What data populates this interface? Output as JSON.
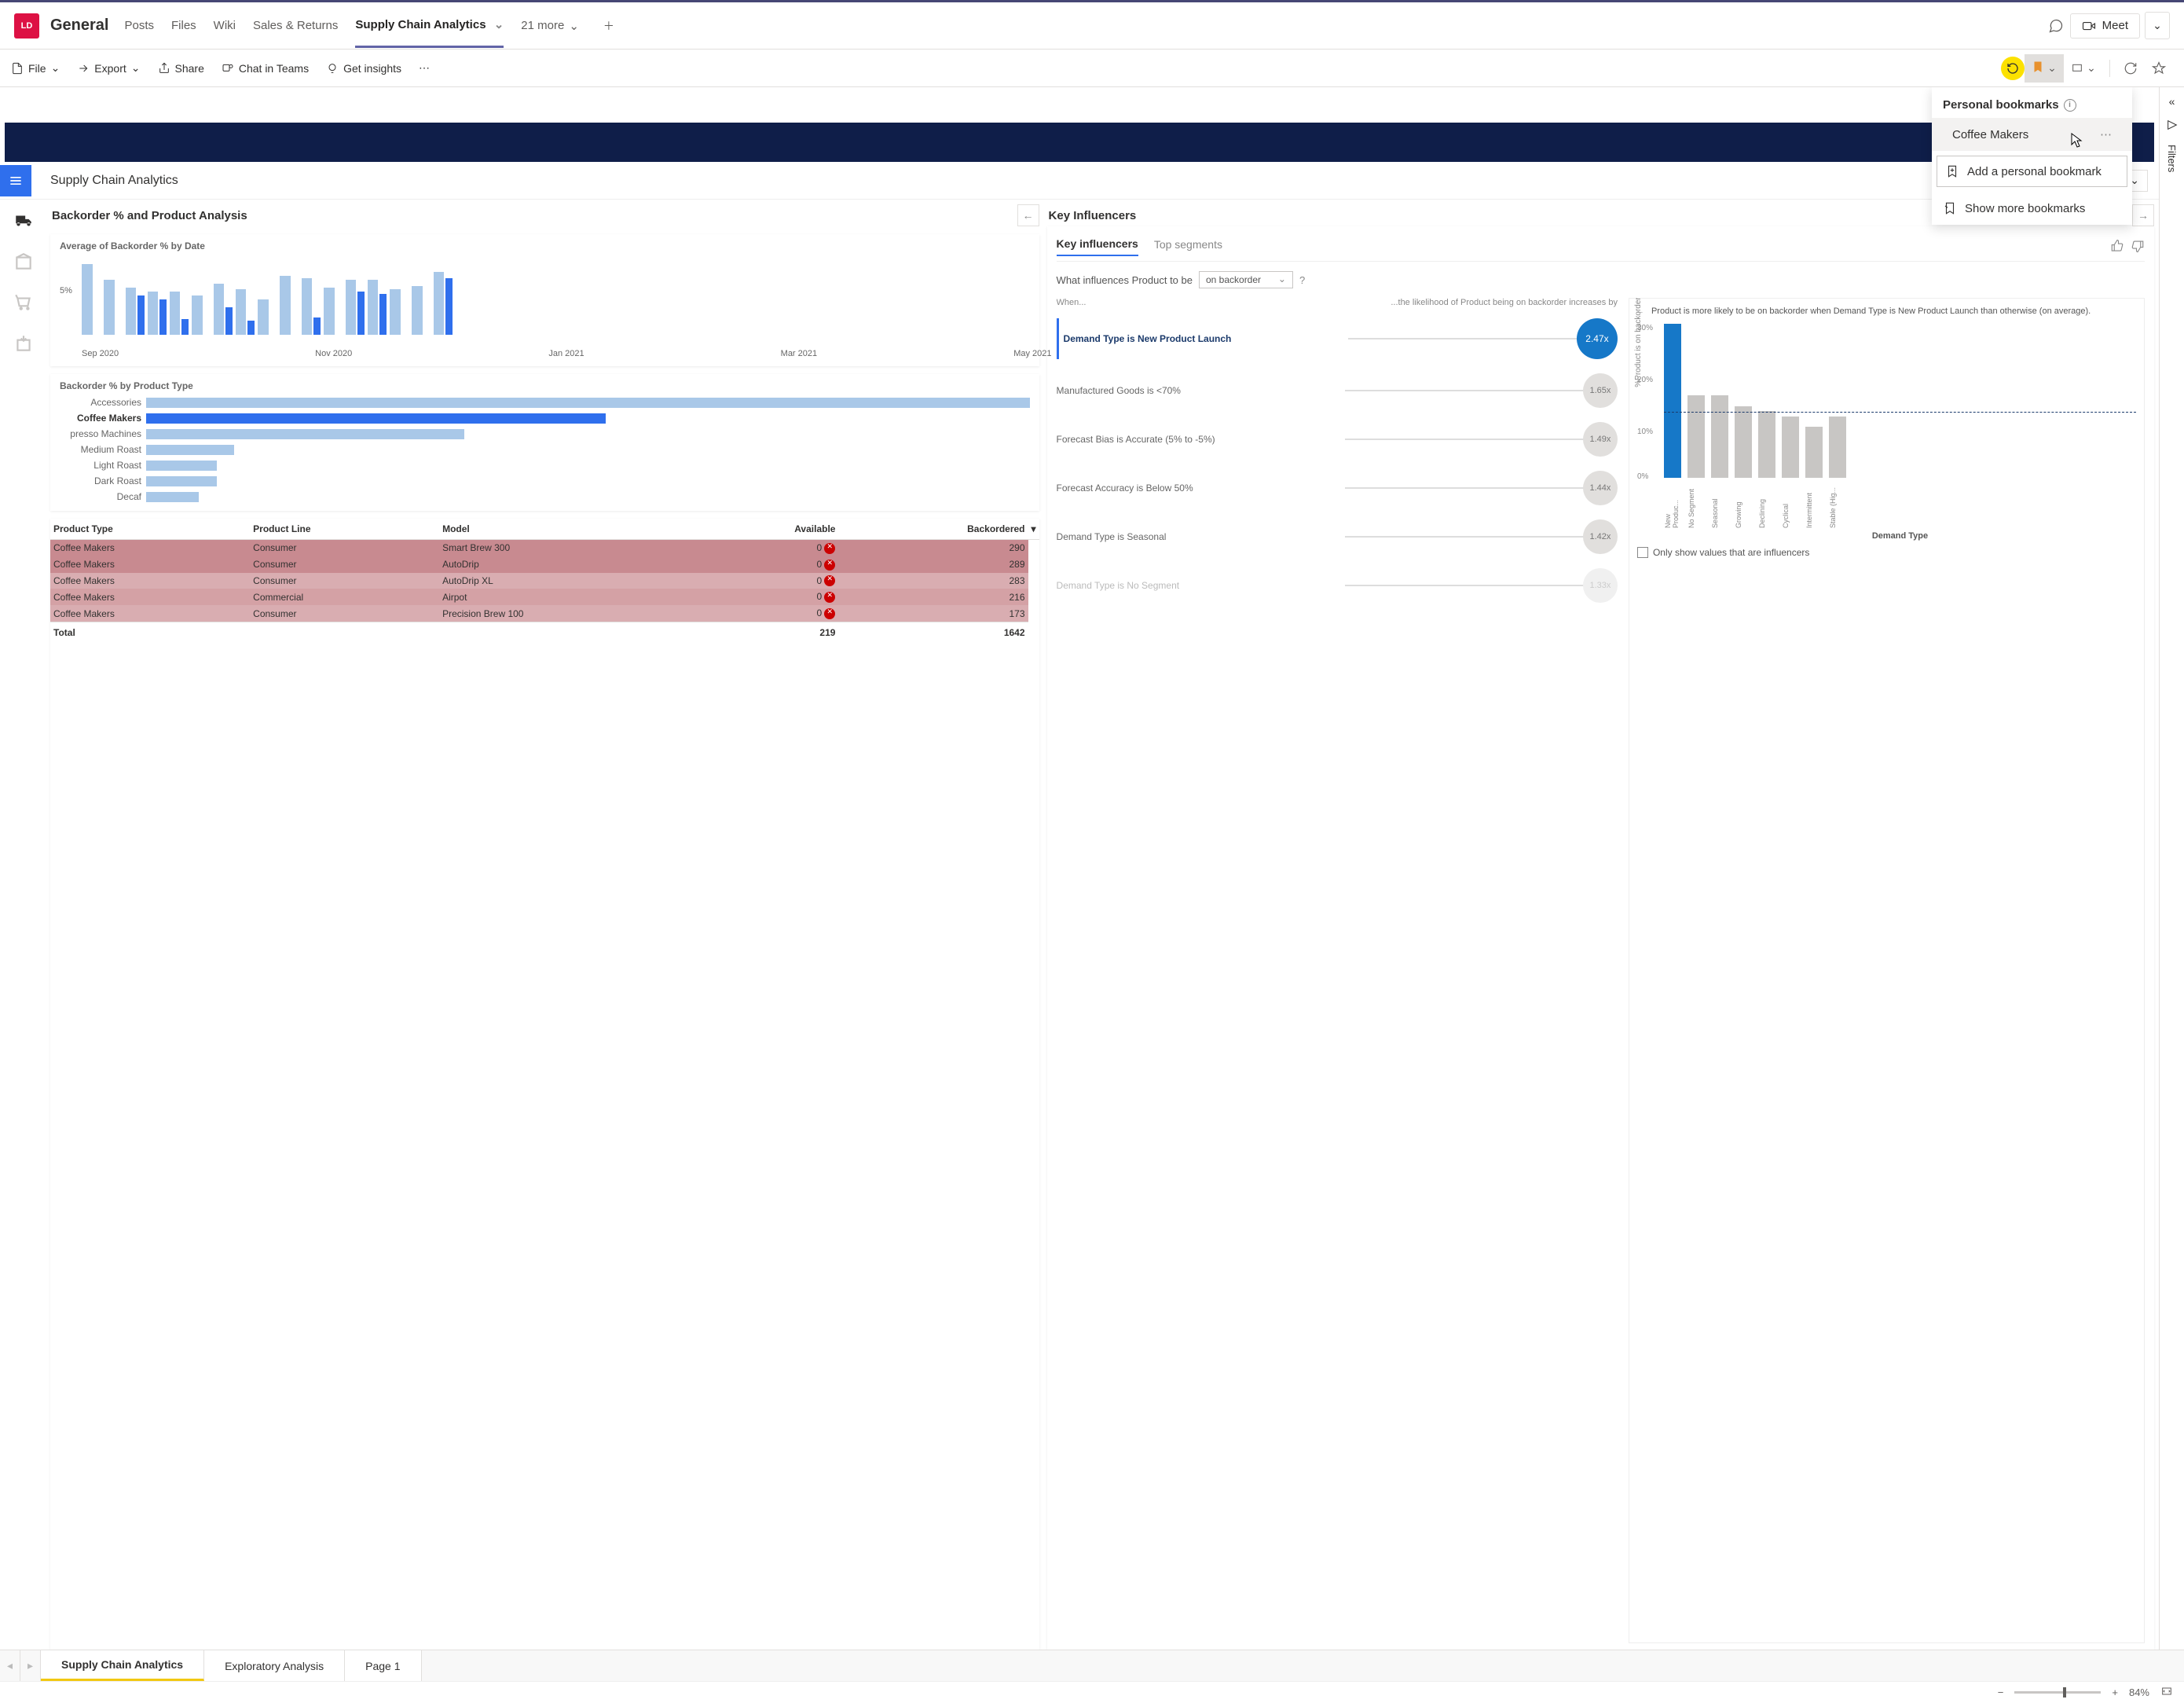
{
  "teams": {
    "avatar": "LD",
    "channel": "General",
    "tabs": [
      "Posts",
      "Files",
      "Wiki",
      "Sales & Returns",
      "Supply Chain Analytics"
    ],
    "more_tabs": "21 more",
    "meet": "Meet"
  },
  "pbi_toolbar": {
    "file": "File",
    "export": "Export",
    "share": "Share",
    "chat": "Chat in Teams",
    "insights": "Get insights"
  },
  "bookmarks": {
    "title": "Personal bookmarks",
    "items": [
      "Coffee Makers"
    ],
    "add": "Add a personal bookmark",
    "show_more": "Show more bookmarks"
  },
  "filters_label": "Filters",
  "report": {
    "title": "Supply Chain Analytics",
    "left_section": "Backorder % and Product Analysis",
    "right_section": "Key Influencers"
  },
  "chart_data": [
    {
      "type": "bar",
      "title": "Average of Backorder % by Date",
      "ylabel": "5%",
      "categories": [
        "Sep 2020",
        "Nov 2020",
        "Jan 2021",
        "Mar 2021",
        "May 2021"
      ],
      "series": [
        {
          "name": "light",
          "values": [
            90,
            70,
            60,
            55,
            55,
            50,
            65,
            58,
            45,
            75,
            72,
            60,
            70,
            70,
            58,
            62,
            80
          ]
        },
        {
          "name": "dark",
          "values": [
            0,
            0,
            50,
            45,
            20,
            0,
            35,
            18,
            0,
            0,
            22,
            0,
            55,
            52,
            0,
            0,
            72
          ]
        }
      ]
    },
    {
      "type": "bar",
      "orientation": "horizontal",
      "title": "Backorder % by Product Type",
      "categories": [
        "Accessories",
        "Coffee Makers",
        "presso Machines",
        "Medium Roast",
        "Light Roast",
        "Dark Roast",
        "Decaf"
      ],
      "values": [
        100,
        52,
        36,
        10,
        8,
        8,
        6
      ],
      "highlight_index": 1
    },
    {
      "type": "bar",
      "title": "Product is more likely to be on backorder when Demand Type is New Product Launch than otherwise (on average).",
      "xlabel": "Demand Type",
      "ylabel": "%Product is on backorder",
      "categories": [
        "New Produc...",
        "No Segment",
        "Seasonal",
        "Growing",
        "Declining",
        "Cyclical",
        "Intermittent",
        "Stable (Hig..."
      ],
      "values": [
        30,
        16,
        16,
        14,
        13,
        12,
        10,
        12
      ],
      "yticks": [
        "30%",
        "20%",
        "10%",
        "0%"
      ],
      "reference_line": 13,
      "highlight_index": 0,
      "checkbox_label": "Only show values that are influencers"
    }
  ],
  "table": {
    "columns": [
      "Product Type",
      "Product Line",
      "Model",
      "Available",
      "Backordered"
    ],
    "rows": [
      [
        "Coffee Makers",
        "Consumer",
        "Smart Brew 300",
        "0",
        "290"
      ],
      [
        "Coffee Makers",
        "Consumer",
        "AutoDrip",
        "0",
        "289"
      ],
      [
        "Coffee Makers",
        "Consumer",
        "AutoDrip XL",
        "0",
        "283"
      ],
      [
        "Coffee Makers",
        "Commercial",
        "Airpot",
        "0",
        "216"
      ],
      [
        "Coffee Makers",
        "Consumer",
        "Precision Brew 100",
        "0",
        "173"
      ]
    ],
    "total_label": "Total",
    "total_available": "219",
    "total_backordered": "1642"
  },
  "ki": {
    "tabs": [
      "Key influencers",
      "Top segments"
    ],
    "question_prefix": "What influences Product to be",
    "dropdown": "on backorder",
    "q_mark": "?",
    "when": "When...",
    "then": "...the likelihood of Product being on backorder increases by",
    "items": [
      {
        "text": "Demand Type is New Product Launch",
        "value": "2.47x",
        "active": true
      },
      {
        "text": "Manufactured Goods is <70%",
        "value": "1.65x"
      },
      {
        "text": "Forecast Bias is Accurate (5% to -5%)",
        "value": "1.49x"
      },
      {
        "text": "Forecast Accuracy is Below 50%",
        "value": "1.44x"
      },
      {
        "text": "Demand Type is Seasonal",
        "value": "1.42x"
      },
      {
        "text": "Demand Type is No Segment",
        "value": "1.33x",
        "fade": true
      }
    ]
  },
  "sheets": {
    "tabs": [
      "Supply Chain Analytics",
      "Exploratory Analysis",
      "Page 1"
    ]
  },
  "zoom": "84%"
}
